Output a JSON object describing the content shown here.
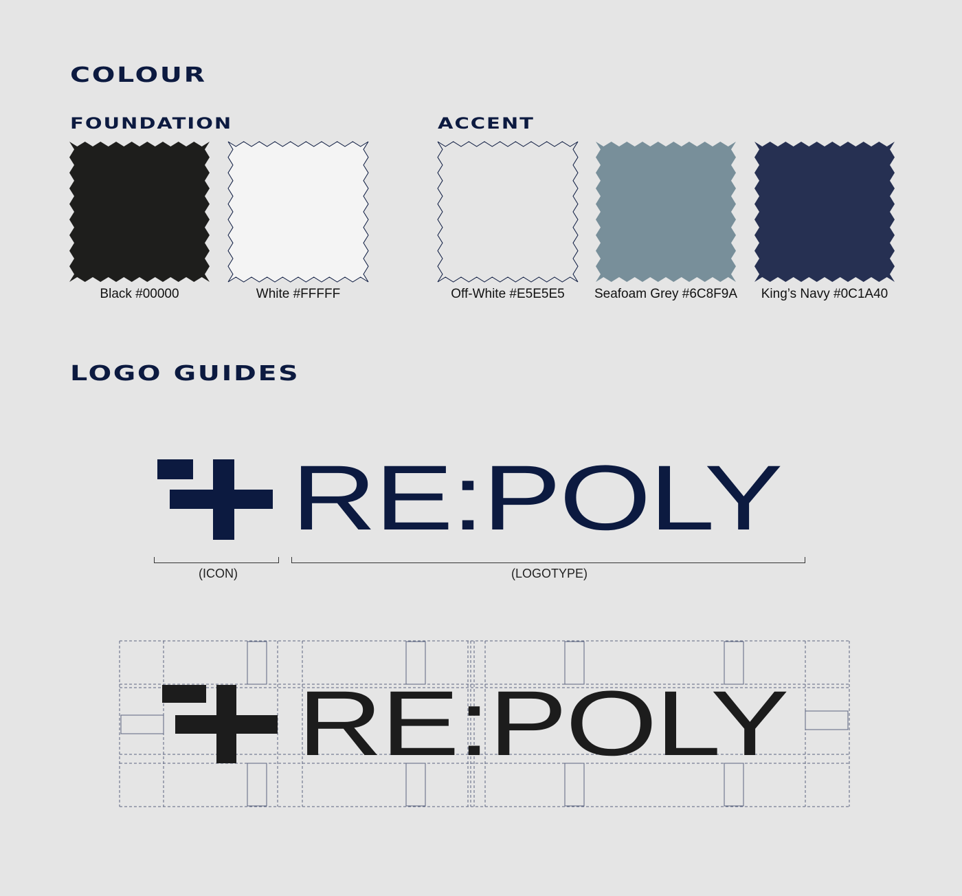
{
  "headings": {
    "colour": "COLOUR",
    "foundation": "FOUNDATION",
    "accent": "ACCENT",
    "logo_guides": "LOGO GUIDES"
  },
  "swatches": [
    {
      "label": "Black #00000",
      "color": "#1e1e1c",
      "outline": false
    },
    {
      "label": "White #FFFFF",
      "color": "#f4f4f4",
      "outline": true
    },
    {
      "label": "Off-White #E5E5E5",
      "color": "#e5e5e5",
      "outline": true
    },
    {
      "label": "Seafoam Grey #6C8F9A",
      "color": "#788f9a",
      "outline": false
    },
    {
      "label": "King’s Navy #0C1A40",
      "color": "#263052",
      "outline": false
    }
  ],
  "logo": {
    "wordmark": "RE:POLY",
    "icon_label": "(ICON)",
    "logotype_label": "(LOGOTYPE)",
    "primary_color": "#0c1a40",
    "guide_color": "#1c1c1c",
    "grid_line_color": "#5a6480"
  }
}
